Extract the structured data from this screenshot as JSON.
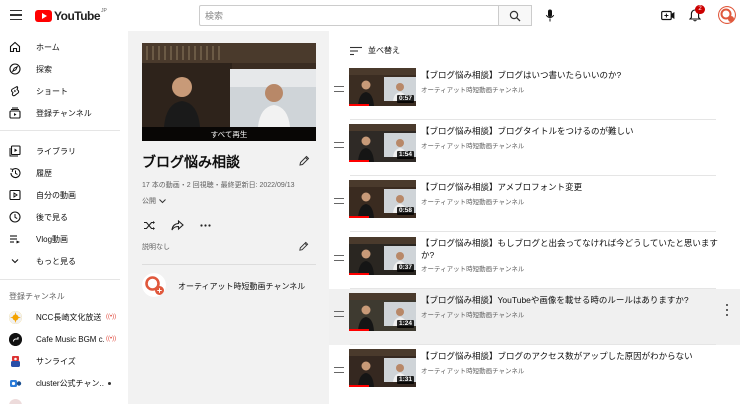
{
  "header": {
    "logo_text": "YouTube",
    "logo_region": "JP",
    "search_placeholder": "検索",
    "notification_count": "2",
    "icons": [
      "menu-icon",
      "search-icon",
      "mic-icon",
      "create-video-icon",
      "bell-icon"
    ]
  },
  "sidebar": {
    "items": [
      {
        "label": "ホーム",
        "icon": "home-icon"
      },
      {
        "label": "探索",
        "icon": "compass-icon"
      },
      {
        "label": "ショート",
        "icon": "shorts-icon"
      },
      {
        "label": "登録チャンネル",
        "icon": "subscriptions-icon"
      },
      {
        "label": "ライブラリ",
        "icon": "library-icon"
      },
      {
        "label": "履歴",
        "icon": "history-icon"
      },
      {
        "label": "自分の動画",
        "icon": "your-videos-icon"
      },
      {
        "label": "後で見る",
        "icon": "watch-later-icon"
      },
      {
        "label": "Vlog動画",
        "icon": "playlist-icon"
      },
      {
        "label": "もっと見る",
        "icon": "chevron-down-icon"
      }
    ],
    "subscriptions_heading": "登録チャンネル",
    "subscriptions": [
      {
        "name": "NCC長崎文化放送",
        "status": "((•))"
      },
      {
        "name": "Cafe Music BGM c...",
        "status": "((•))"
      },
      {
        "name": "サンライズ",
        "status": ""
      },
      {
        "name": "cluster公式チャン...",
        "status": "•"
      }
    ]
  },
  "playlist": {
    "play_all": "すべて再生",
    "title": "ブログ悩み相談",
    "stats": "17 本の動画・2 回視聴・最終更新日: 2022/09/13",
    "privacy": "公開",
    "description": "説明なし",
    "owner": "オーティアット時短動画チャンネル"
  },
  "list": {
    "sort_label": "並べ替え",
    "videos": [
      {
        "title": "【ブログ悩み相談】ブログはいつ書いたらいいのか?",
        "channel": "オーティアット時短動画チャンネル",
        "duration": "0:57",
        "progress": 0.3
      },
      {
        "title": "【ブログ悩み相談】ブログタイトルをつけるのが難しい",
        "channel": "オーティアット時短動画チャンネル",
        "duration": "1:54",
        "progress": 0.3
      },
      {
        "title": "【ブログ悩み相談】アメブロフォント変更",
        "channel": "オーティアット時短動画チャンネル",
        "duration": "0:58",
        "progress": 0.3
      },
      {
        "title": "【ブログ悩み相談】もしブログと出会ってなければ今どうしていたと思いますか?",
        "channel": "オーティアット時短動画チャンネル",
        "duration": "0:37",
        "progress": 0.3
      },
      {
        "title": "【ブログ悩み相談】YouTubeや画像を載せる時のルールはありますか?",
        "channel": "オーティアット時短動画チャンネル",
        "duration": "1:24",
        "progress": 0.3
      },
      {
        "title": "【ブログ悩み相談】ブログのアクセス数がアップした原因がわからない",
        "channel": "オーティアット時短動画チャンネル",
        "duration": "1:31",
        "progress": 0.3
      }
    ]
  },
  "colors": {
    "brand_red": "#ff0000",
    "panel_bg": "#f2f2f2",
    "accent_orange": "#e0583c"
  }
}
